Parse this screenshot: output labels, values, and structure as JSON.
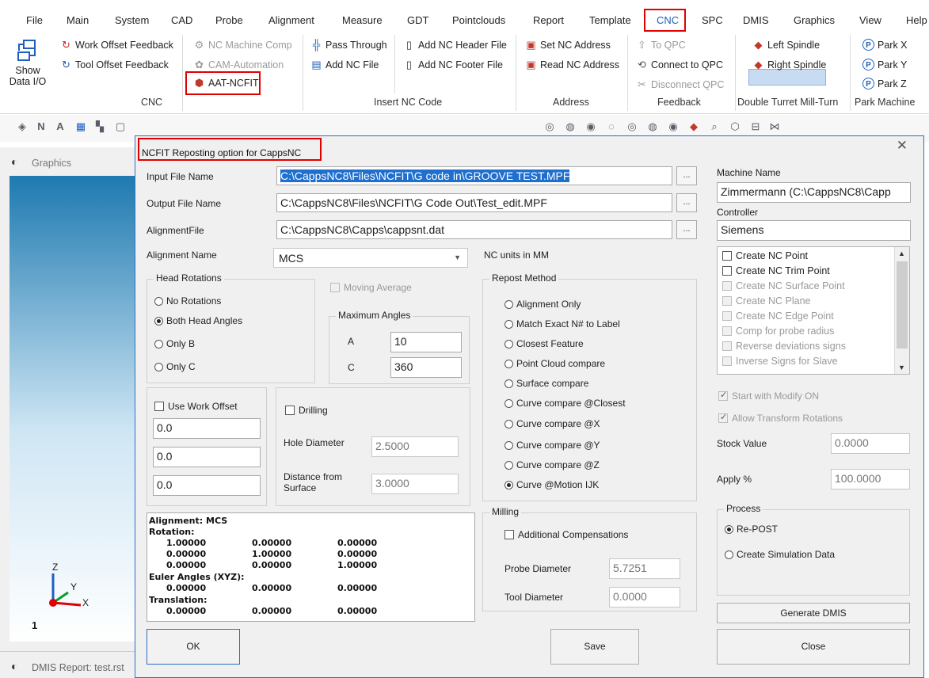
{
  "menu": {
    "items": [
      "File",
      "Main",
      "System",
      "CAD",
      "Probe",
      "Alignment",
      "Measure",
      "GDT",
      "Pointclouds",
      "Report",
      "Template",
      "CNC",
      "SPC",
      "DMIS",
      "Graphics",
      "View",
      "Help"
    ],
    "active": "CNC"
  },
  "ribbon": {
    "show_data_io": [
      "Show",
      "Data I/O"
    ],
    "work_offset_feedback": "Work Offset Feedback",
    "tool_offset_feedback": "Tool Offset Feedback",
    "nc_machine_comp": "NC Machine Comp",
    "cam_automation": "CAM-Automation",
    "aat_ncfit": "AAT-NCFIT",
    "pass_through": "Pass Through",
    "add_nc_file": "Add NC File",
    "add_nc_header_file": "Add NC Header File",
    "add_nc_footer_file": "Add NC Footer File",
    "set_nc_address": "Set NC Address",
    "read_nc_address": "Read NC Address",
    "to_qpc": "To QPC",
    "connect_to_qpc": "Connect to QPC",
    "disconnect_qpc": "Disconnect QPC",
    "left_spindle": "Left Spindle",
    "right_spindle": "Right Spindle",
    "park_x": "Park X",
    "park_y": "Park Y",
    "park_z": "Park Z",
    "groups": {
      "cnc": "CNC",
      "insert_nc_code": "Insert NC Code",
      "address": "Address",
      "feedback": "Feedback",
      "double_turret": "Double Turret Mill-Turn",
      "park_machine": "Park Machine"
    }
  },
  "panels": {
    "graphics_title": "Graphics",
    "status_report": "DMIS Report: test.rst",
    "viewport_number": "1",
    "axis_z": "Z",
    "axis_y": "Y",
    "axis_x": "X"
  },
  "dialog": {
    "title": "NCFIT Reposting option for CappsNC",
    "close": "✕",
    "input_file_label": "Input File Name",
    "input_file_value": "C:\\CappsNC8\\Files\\NCFIT\\G code in\\GROOVE TEST.MPF",
    "output_file_label": "Output File Name",
    "output_file_value": "C:\\CappsNC8\\Files\\NCFIT\\G Code Out\\Test_edit.MPF",
    "alignment_file_label": "AlignmentFile",
    "alignment_file_value": "C:\\CappsNC8\\Capps\\cappsnt.dat",
    "browse": "...",
    "alignment_name_label": "Alignment Name",
    "alignment_name_value": "MCS",
    "nc_units": "NC units in MM",
    "machine_name_label": "Machine Name",
    "machine_name_value": "Zimmermann   (C:\\CappsNC8\\Capp",
    "controller_label": "Controller",
    "controller_value": "Siemens",
    "head_rotations": {
      "title": "Head Rotations",
      "options": [
        "No Rotations",
        "Both Head Angles",
        "Only B",
        "Only C"
      ],
      "selected": 1
    },
    "moving_average": "Moving Average",
    "max_angles": {
      "title": "Maximum  Angles",
      "a_label": "A",
      "a_value": "10",
      "c_label": "C",
      "c_value": "360"
    },
    "work_offset": {
      "label": "Use Work Offset",
      "values": [
        "0.0",
        "0.0",
        "0.0"
      ]
    },
    "drilling": {
      "label": "Drilling",
      "hole_diameter_label": "Hole Diameter",
      "hole_diameter_value": "2.5000",
      "distance_label": [
        "Distance from",
        "Surface"
      ],
      "distance_value": "3.0000"
    },
    "repost_method": {
      "title": "Repost Method",
      "options": [
        "Alignment Only",
        "Match Exact N# to Label",
        "Closest Feature",
        "Point Cloud compare",
        "Surface compare",
        "Curve compare @Closest",
        "Curve compare @X",
        "Curve compare @Y",
        "Curve compare @Z",
        "Curve @Motion IJK"
      ],
      "selected": 9
    },
    "milling": {
      "title": "Milling",
      "additional_comp": "Additional Compensations",
      "probe_diameter_label": "Probe Diameter",
      "probe_diameter_value": "5.7251",
      "tool_diameter_label": "Tool Diameter",
      "tool_diameter_value": "0.0000"
    },
    "checklist": [
      {
        "label": "Create NC Point",
        "enabled": true
      },
      {
        "label": "Create NC Trim Point",
        "enabled": true
      },
      {
        "label": "Create NC Surface Point",
        "enabled": false
      },
      {
        "label": "Create NC Plane",
        "enabled": false
      },
      {
        "label": "Create NC Edge Point",
        "enabled": false
      },
      {
        "label": "Comp for probe radius",
        "enabled": false
      },
      {
        "label": "Reverse deviations signs",
        "enabled": false
      },
      {
        "label": "Inverse Signs for Slave",
        "enabled": false
      }
    ],
    "start_with_modify": "Start with Modify ON",
    "allow_transform": "Allow Transform Rotations",
    "stock_value_label": "Stock Value",
    "stock_value": "0.0000",
    "apply_label": "Apply  %",
    "apply_value": "100.0000",
    "process": {
      "title": "Process",
      "options": [
        "Re-POST",
        "Create Simulation Data"
      ],
      "selected": 0
    },
    "generate_dmis": "Generate DMIS",
    "info": {
      "alignment": "Alignment: MCS",
      "rotation": "Rotation:",
      "rot_rows": [
        [
          "1.00000",
          "0.00000",
          "0.00000"
        ],
        [
          "0.00000",
          "1.00000",
          "0.00000"
        ],
        [
          "0.00000",
          "0.00000",
          "1.00000"
        ]
      ],
      "euler": "Euler Angles (XYZ):",
      "euler_row": [
        "0.00000",
        "0.00000",
        "0.00000"
      ],
      "translation": "Translation:",
      "trans_row": [
        "0.00000",
        "0.00000",
        "0.00000"
      ]
    },
    "ok": "OK",
    "save": "Save",
    "close_btn": "Close"
  },
  "colors": {
    "highlight_red": "#e00000",
    "accent_blue": "#2d6fc4",
    "selection": "#1f6fcf"
  }
}
